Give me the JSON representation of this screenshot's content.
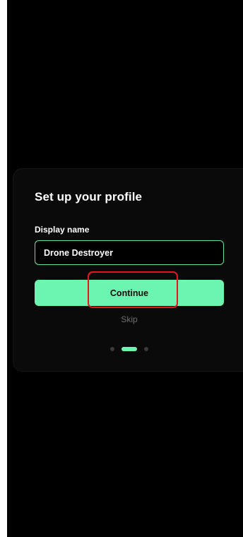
{
  "profile": {
    "title": "Set up your profile",
    "display_name_label": "Display name",
    "display_name_value": "Drone Destroyer",
    "continue_label": "Continue",
    "skip_label": "Skip"
  },
  "pagination": {
    "total": 3,
    "current": 2
  },
  "colors": {
    "accent": "#6cf5b0",
    "background": "#000000",
    "highlight": "#e8141c"
  }
}
